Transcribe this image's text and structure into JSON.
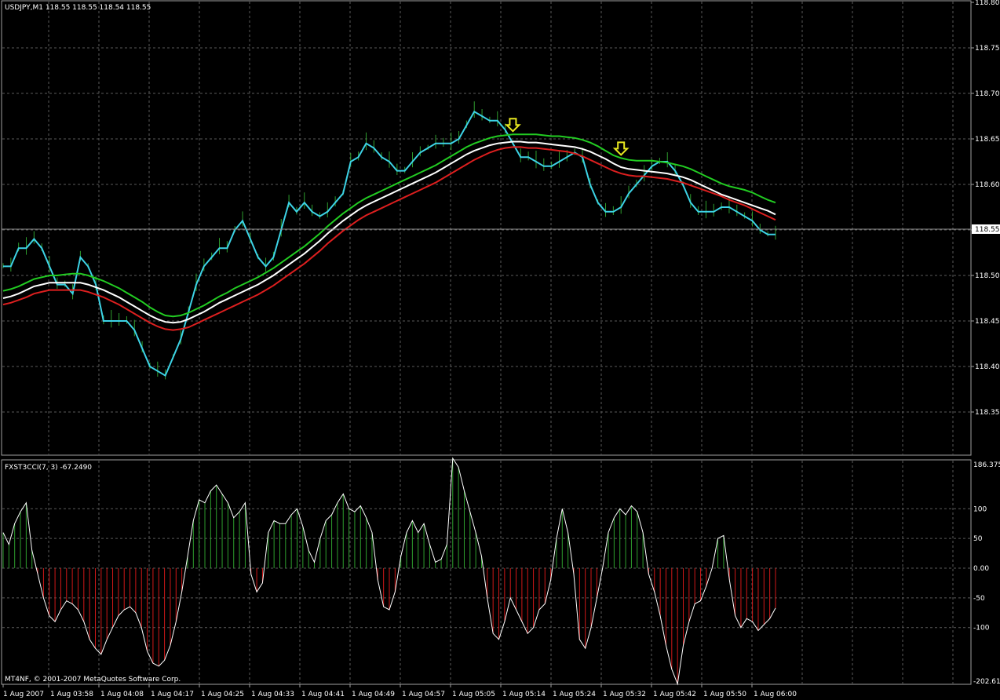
{
  "colors": {
    "background": "#000000",
    "grid": "#5a5a5a",
    "frame": "#a0a0a0",
    "axis_text": "#ffffff",
    "bars": "#2e9e2e",
    "ma_green": "#22cc22",
    "ma_white": "#ffffff",
    "ma_red": "#dd1f1f",
    "price_cyan": "#3dd3e6",
    "arrow": "#e8e820",
    "cci_line": "#ffffff",
    "cci_pos": "#2e9e2e",
    "cci_neg": "#d01818"
  },
  "main_panel": {
    "header": "USDJPY,M1  118.55 118.55 118.54 118.55",
    "current_price_label": "118.55",
    "price_ticks": [
      "118.80",
      "118.75",
      "118.70",
      "118.65",
      "118.60",
      "118.55",
      "118.50",
      "118.45",
      "118.40",
      "118.35"
    ]
  },
  "sub_panel": {
    "header": "FXST3CCI(7, 3) -67.2490",
    "ticks": [
      "186.375",
      "100",
      "50",
      "0.00",
      "-50",
      "-100",
      "-202.614"
    ],
    "copyright": "MT4NF, © 2001-2007 MetaQuotes Software Corp."
  },
  "time_axis": [
    "1 Aug 2007",
    "1 Aug 03:58",
    "1 Aug 04:08",
    "1 Aug 04:17",
    "1 Aug 04:25",
    "1 Aug 04:33",
    "1 Aug 04:41",
    "1 Aug 04:49",
    "1 Aug 04:57",
    "1 Aug 05:05",
    "1 Aug 05:14",
    "1 Aug 05:24",
    "1 Aug 05:32",
    "1 Aug 05:42",
    "1 Aug 05:50",
    "1 Aug 06:00"
  ],
  "chart_data": [
    {
      "type": "line",
      "title": "USDJPY,M1",
      "ylim": [
        118.305,
        118.8
      ],
      "current_price": 118.55,
      "series": [
        {
          "key": "cyan",
          "values": [
            118.51,
            118.51,
            118.53,
            118.53,
            118.54,
            118.53,
            118.51,
            118.49,
            118.49,
            118.48,
            118.52,
            118.51,
            118.49,
            118.45,
            118.45,
            118.45,
            118.45,
            118.44,
            118.42,
            118.4,
            118.395,
            118.39,
            118.41,
            118.43,
            118.46,
            118.49,
            118.51,
            118.52,
            118.53,
            118.53,
            118.55,
            118.56,
            118.54,
            118.52,
            118.51,
            118.52,
            118.55,
            118.58,
            118.57,
            118.58,
            118.57,
            118.565,
            118.57,
            118.58,
            118.59,
            118.625,
            118.63,
            118.645,
            118.64,
            118.63,
            118.625,
            118.615,
            118.615,
            118.625,
            118.635,
            118.64,
            118.645,
            118.645,
            118.645,
            118.65,
            118.665,
            118.68,
            118.675,
            118.67,
            118.67,
            118.66,
            118.645,
            118.63,
            118.63,
            118.625,
            118.62,
            118.62,
            118.625,
            118.63,
            118.635,
            118.63,
            118.6,
            118.58,
            118.57,
            118.57,
            118.575,
            118.59,
            118.6,
            118.61,
            118.62,
            118.625,
            118.625,
            118.615,
            118.6,
            118.58,
            118.57,
            118.57,
            118.57,
            118.575,
            118.575,
            118.57,
            118.565,
            118.56,
            118.55,
            118.545,
            118.545
          ]
        },
        {
          "key": "green",
          "values": [
            118.483,
            118.485,
            118.488,
            118.492,
            118.496,
            118.498,
            118.5,
            118.5,
            118.501,
            118.502,
            118.502,
            118.5,
            118.497,
            118.494,
            118.49,
            118.486,
            118.481,
            118.476,
            118.471,
            118.465,
            118.46,
            118.456,
            118.455,
            118.456,
            118.459,
            118.463,
            118.467,
            118.472,
            118.477,
            118.481,
            118.486,
            118.49,
            118.494,
            118.498,
            118.503,
            118.508,
            118.514,
            118.52,
            118.526,
            118.532,
            118.539,
            118.546,
            118.554,
            118.561,
            118.568,
            118.574,
            118.58,
            118.585,
            118.589,
            118.593,
            118.597,
            118.601,
            118.605,
            118.609,
            118.613,
            118.617,
            118.621,
            118.626,
            118.631,
            118.636,
            118.641,
            118.645,
            118.648,
            118.651,
            118.653,
            118.654,
            118.655,
            118.655,
            118.655,
            118.655,
            118.654,
            118.653,
            118.653,
            118.652,
            118.651,
            118.649,
            118.646,
            118.642,
            118.637,
            118.632,
            118.629,
            118.627,
            118.626,
            118.626,
            118.626,
            118.625,
            118.624,
            118.622,
            118.62,
            118.617,
            118.613,
            118.609,
            118.605,
            118.601,
            118.598,
            118.596,
            118.594,
            118.591,
            118.587,
            118.583,
            118.58
          ]
        },
        {
          "key": "white",
          "values": [
            118.475,
            118.477,
            118.48,
            118.484,
            118.488,
            118.49,
            118.492,
            118.492,
            118.492,
            118.492,
            118.492,
            118.49,
            118.487,
            118.484,
            118.48,
            118.476,
            118.471,
            118.466,
            118.461,
            118.456,
            118.452,
            118.449,
            118.448,
            118.449,
            118.452,
            118.456,
            118.46,
            118.465,
            118.47,
            118.474,
            118.478,
            118.482,
            118.486,
            118.49,
            118.495,
            118.5,
            118.506,
            118.512,
            118.518,
            118.524,
            118.531,
            118.538,
            118.546,
            118.553,
            118.56,
            118.566,
            118.572,
            118.577,
            118.581,
            118.585,
            118.589,
            118.593,
            118.597,
            118.601,
            118.605,
            118.609,
            118.613,
            118.618,
            118.623,
            118.628,
            118.633,
            118.637,
            118.64,
            118.643,
            118.645,
            118.646,
            118.647,
            118.647,
            118.646,
            118.646,
            118.645,
            118.644,
            118.643,
            118.642,
            118.641,
            118.639,
            118.636,
            118.632,
            118.628,
            118.623,
            118.619,
            118.617,
            118.616,
            118.615,
            118.614,
            118.613,
            118.612,
            118.61,
            118.608,
            118.605,
            118.601,
            118.597,
            118.593,
            118.589,
            118.586,
            118.583,
            118.58,
            118.577,
            118.574,
            118.571,
            118.567
          ]
        },
        {
          "key": "red",
          "values": [
            118.468,
            118.47,
            118.473,
            118.476,
            118.48,
            118.482,
            118.484,
            118.484,
            118.484,
            118.484,
            118.484,
            118.482,
            118.479,
            118.476,
            118.472,
            118.468,
            118.463,
            118.458,
            118.453,
            118.448,
            118.444,
            118.441,
            118.44,
            118.441,
            118.443,
            118.447,
            118.451,
            118.455,
            118.459,
            118.463,
            118.467,
            118.471,
            118.475,
            118.479,
            118.484,
            118.489,
            118.495,
            118.501,
            118.507,
            118.513,
            118.52,
            118.527,
            118.535,
            118.542,
            118.549,
            118.555,
            118.561,
            118.566,
            118.57,
            118.574,
            118.578,
            118.582,
            118.586,
            118.59,
            118.594,
            118.598,
            118.602,
            118.607,
            118.612,
            118.617,
            118.622,
            118.627,
            118.631,
            118.635,
            118.638,
            118.64,
            118.641,
            118.641,
            118.64,
            118.64,
            118.639,
            118.638,
            118.637,
            118.636,
            118.634,
            118.631,
            118.627,
            118.623,
            118.619,
            118.615,
            118.612,
            118.61,
            118.609,
            118.609,
            118.608,
            118.607,
            118.606,
            118.604,
            118.602,
            118.599,
            118.596,
            118.593,
            118.59,
            118.587,
            118.583,
            118.58,
            118.577,
            118.573,
            118.569,
            118.565,
            118.561
          ]
        }
      ],
      "sell_arrows_at_index": [
        66,
        80
      ]
    },
    {
      "type": "bar",
      "title": "FXST3CCI(7, 3)",
      "ylim": [
        -202.614,
        186.375
      ],
      "last_value": -67.249,
      "values": [
        60,
        40,
        75,
        95,
        110,
        30,
        -10,
        -50,
        -80,
        -90,
        -70,
        -55,
        -60,
        -70,
        -90,
        -120,
        -135,
        -145,
        -120,
        -100,
        -80,
        -70,
        -65,
        -75,
        -100,
        -140,
        -160,
        -165,
        -155,
        -130,
        -90,
        -40,
        20,
        80,
        115,
        110,
        130,
        140,
        125,
        110,
        85,
        95,
        110,
        -10,
        -40,
        -25,
        60,
        80,
        75,
        75,
        90,
        100,
        70,
        30,
        10,
        50,
        80,
        90,
        110,
        125,
        100,
        95,
        105,
        85,
        60,
        -20,
        -65,
        -70,
        -40,
        20,
        60,
        80,
        60,
        75,
        40,
        10,
        15,
        40,
        185,
        170,
        130,
        95,
        60,
        20,
        -50,
        -110,
        -120,
        -90,
        -50,
        -70,
        -90,
        -110,
        -100,
        -70,
        -60,
        -20,
        50,
        100,
        60,
        -10,
        -120,
        -135,
        -100,
        -50,
        0,
        60,
        85,
        100,
        90,
        105,
        95,
        60,
        -10,
        -40,
        -80,
        -130,
        -170,
        -195,
        -130,
        -90,
        -60,
        -55,
        -30,
        0,
        50,
        55,
        -20,
        -80,
        -100,
        -85,
        -90,
        -105,
        -95,
        -85,
        -67.249
      ]
    }
  ]
}
